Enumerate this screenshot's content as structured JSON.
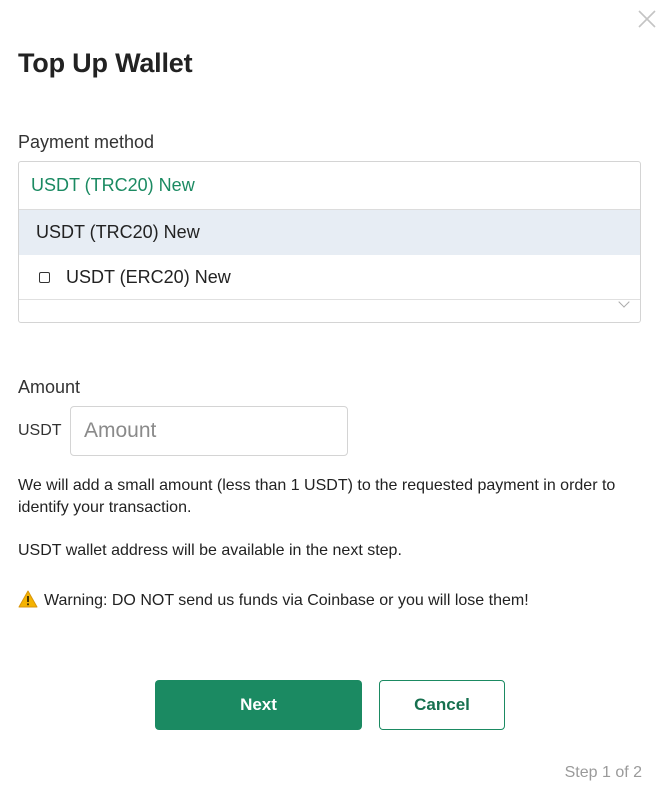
{
  "dialog": {
    "title": "Top Up Wallet",
    "close_icon": "close-icon"
  },
  "payment_method": {
    "label": "Payment method",
    "selected": "USDT (TRC20) New",
    "options": [
      {
        "label": "USDT (TRC20) New",
        "highlighted": true
      },
      {
        "label": "USDT (ERC20) New",
        "highlighted": false
      }
    ]
  },
  "amount": {
    "label": "Amount",
    "currency": "USDT",
    "placeholder": "Amount",
    "value": ""
  },
  "info": {
    "note": "We will add a small amount (less than 1 USDT) to the requested payment in order to identify your transaction.",
    "address_note": "USDT wallet address will be available in the next step.",
    "warning": "Warning: DO NOT send us funds via Coinbase or you will lose them!",
    "warning_icon": "warning-icon"
  },
  "actions": {
    "next_label": "Next",
    "cancel_label": "Cancel"
  },
  "footer": {
    "step": "Step 1 of 2"
  },
  "colors": {
    "accent": "#1b8a62",
    "highlight": "#e7edf4"
  }
}
